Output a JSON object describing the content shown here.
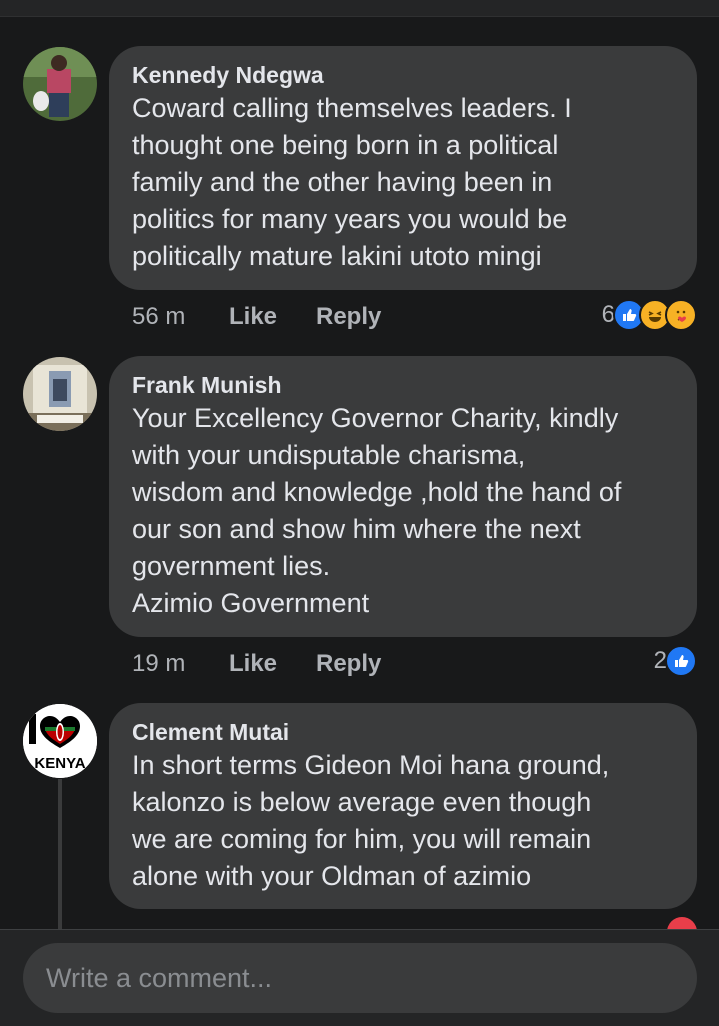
{
  "comments": [
    {
      "author": "Kennedy Ndegwa",
      "text": "Coward calling themselves leaders. I\nthought one being born in a political\nfamily and the other having been in\npolitics for many years you would be\npolitically mature lakini utoto mingi",
      "time": "56 m",
      "like_label": "Like",
      "reply_label": "Reply",
      "reaction_count": "6",
      "reactions": [
        "like",
        "haha",
        "care"
      ]
    },
    {
      "author": "Frank Munish",
      "text": "Your Excellency Governor Charity, kindly\nwith your undisputable charisma,\nwisdom and knowledge ,hold the hand of\nour son and show him where the next\ngovernment lies.\nAzimio Government",
      "time": "19 m",
      "like_label": "Like",
      "reply_label": "Reply",
      "reaction_count": "2",
      "reactions": [
        "like"
      ]
    },
    {
      "author": "Clement Mutai",
      "text": "In short terms Gideon Moi hana ground,\nkalonzo is below average even though\nwe are coming for him, you will remain\nalone with your Oldman of azimio",
      "avatar_text": "KENYA"
    }
  ],
  "composer": {
    "placeholder": "Write a comment..."
  },
  "colors": {
    "like": "#2078f4",
    "haha": "#f7b125",
    "care": "#f7b125",
    "heart": "#e83e4a"
  }
}
